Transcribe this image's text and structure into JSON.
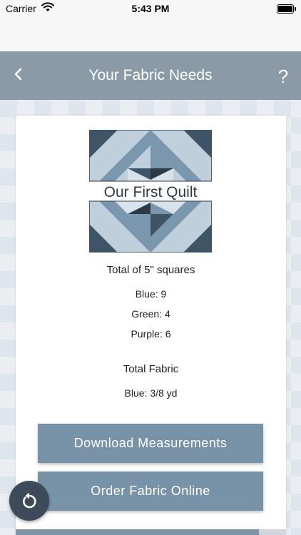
{
  "status_bar": {
    "carrier": "Carrier",
    "time": "5:43 PM"
  },
  "nav": {
    "back_icon": "chevron-left-icon",
    "title": "Your Fabric Needs",
    "help_label": "?"
  },
  "logo": {
    "text": "Our First Quilt"
  },
  "squares": {
    "heading": "Total of 5\" squares",
    "items": [
      {
        "label": "Blue: 9"
      },
      {
        "label": "Green: 4"
      },
      {
        "label": "Purple: 6"
      }
    ]
  },
  "fabric": {
    "heading": "Total Fabric",
    "items": [
      {
        "label": "Blue: 3/8 yd"
      }
    ]
  },
  "buttons": {
    "download": "Download Measurements",
    "order": "Order Fabric Online"
  },
  "progress": {
    "fraction": 0.9
  },
  "fab": {
    "icon": "refresh-icon"
  },
  "colors": {
    "nav_bar": "#8a9aa6",
    "button": "#7892a7",
    "fab": "#3c4a59",
    "quilt_dark": "#3f5567",
    "quilt_mid": "#7b97ad",
    "quilt_light": "#bfcfdc"
  }
}
